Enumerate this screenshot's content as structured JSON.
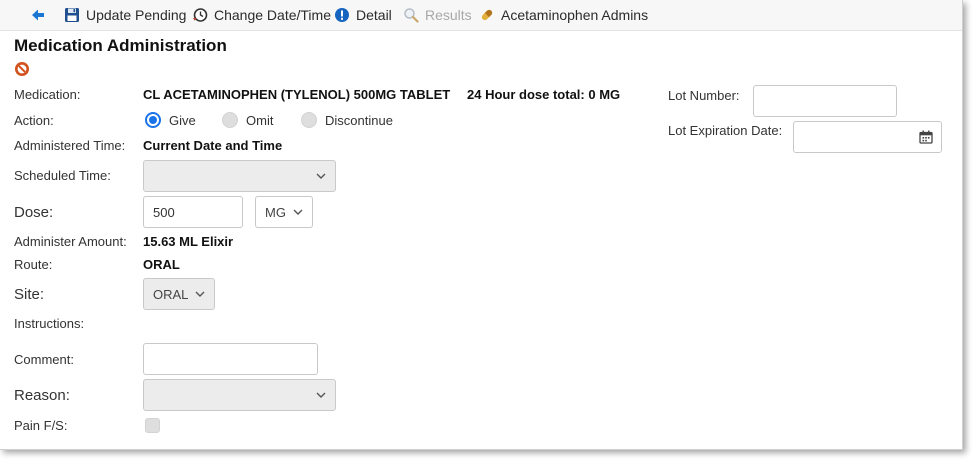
{
  "toolbar": {
    "back_icon": "back-arrow-icon",
    "update_pending": "Update Pending",
    "change_date_time": "Change Date/Time",
    "detail": "Detail",
    "results": "Results",
    "acetaminophen_admins": "Acetaminophen Admins"
  },
  "title": "Medication Administration",
  "labels": {
    "medication": "Medication:",
    "action": "Action:",
    "administered_time": "Administered Time:",
    "scheduled_time": "Scheduled Time:",
    "dose": "Dose:",
    "administer_amount": "Administer Amount:",
    "route": "Route:",
    "site": "Site:",
    "instructions": "Instructions:",
    "comment": "Comment:",
    "reason": "Reason:",
    "pain": "Pain F/S:",
    "lot_number": "Lot Number:",
    "lot_expiration": "Lot Expiration Date:"
  },
  "values": {
    "medication": "CL ACETAMINOPHEN (TYLENOL) 500MG TABLET",
    "dose_total": "24 Hour dose total: 0 MG",
    "administered_time": "Current Date and Time",
    "administer_amount": "15.63 ML Elixir",
    "route": "ORAL"
  },
  "action_options": [
    {
      "label": "Give",
      "selected": true
    },
    {
      "label": "Omit",
      "selected": false
    },
    {
      "label": "Discontinue",
      "selected": false
    }
  ],
  "fields": {
    "scheduled_time": "",
    "dose_value": "500",
    "dose_unit": "MG",
    "site": "ORAL",
    "comment": "",
    "reason": "",
    "lot_number": "",
    "lot_expiration": ""
  },
  "colors": {
    "accent": "#1a73e8",
    "toolbar_icon_blue": "#1565c0",
    "disabled_text": "#a8a8a8"
  }
}
